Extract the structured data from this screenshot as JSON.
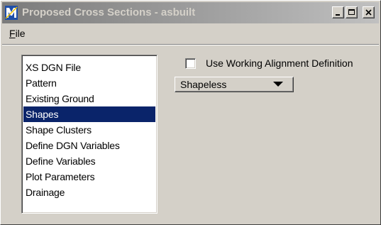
{
  "window": {
    "title": "Proposed Cross Sections - asbuilt",
    "app_icon": "microstation-geopak-icon",
    "controls": [
      "minimize-icon",
      "maximize-icon",
      "close-icon"
    ]
  },
  "menu": {
    "file_mnemonic": "F",
    "file_rest": "ile"
  },
  "list": {
    "items": [
      "XS DGN File",
      "Pattern",
      "Existing Ground",
      "Shapes",
      "Shape Clusters",
      "Define DGN Variables",
      "Define Variables",
      "Plot Parameters",
      "Drainage"
    ],
    "selected": "Shapes"
  },
  "options": {
    "working_alignment_label": "Use Working Alignment Definition",
    "working_alignment_checked": false,
    "shape_mode_value": "Shapeless"
  },
  "colors": {
    "face": "#d4d0c8",
    "selection": "#0a246a",
    "title_text": "#d4d0c8"
  }
}
